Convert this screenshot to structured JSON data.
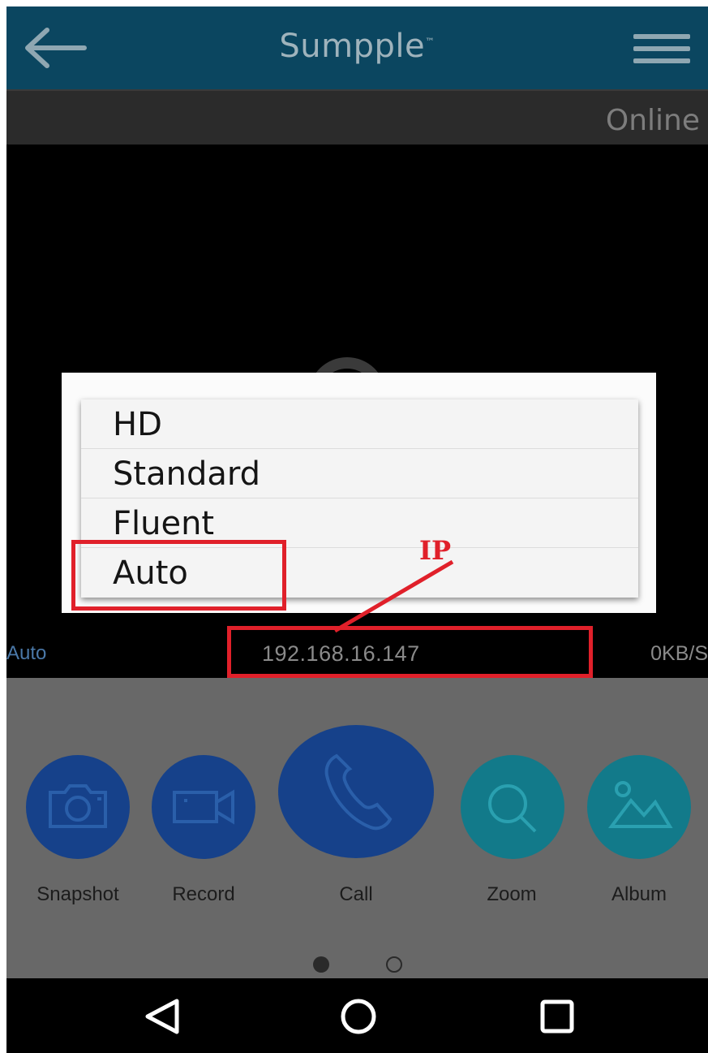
{
  "header": {
    "brand": "Sumpple",
    "brand_mark": "™"
  },
  "status": {
    "connection": "Online"
  },
  "quality_menu": {
    "options": [
      {
        "label": "HD"
      },
      {
        "label": "Standard"
      },
      {
        "label": "Fluent"
      },
      {
        "label": "Auto"
      }
    ],
    "highlighted": "Auto"
  },
  "info": {
    "mode": "Auto",
    "ip": "192.168.16.147",
    "rate": "0KB/S"
  },
  "controls": [
    {
      "label": "Snapshot",
      "icon": "camera-icon"
    },
    {
      "label": "Record",
      "icon": "video-camera-icon"
    },
    {
      "label": "Call",
      "icon": "phone-icon"
    },
    {
      "label": "Zoom",
      "icon": "magnifier-icon"
    },
    {
      "label": "Album",
      "icon": "image-icon"
    }
  ],
  "pager": {
    "page": 1,
    "pages": 2
  },
  "annotation": {
    "label": "IP"
  },
  "colors": {
    "header": "#0b4660",
    "annotation": "#e0202a",
    "button_blue": "#16418a",
    "button_teal": "#127a8a"
  }
}
